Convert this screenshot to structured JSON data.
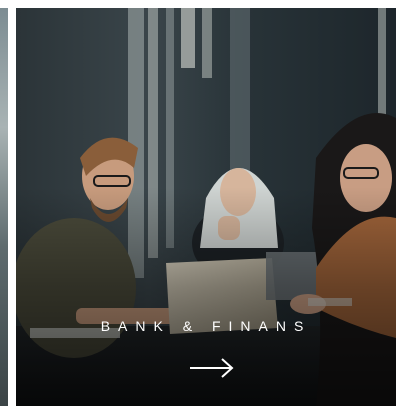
{
  "card": {
    "title": "BANK & FINANS",
    "image": "business-meeting-photo",
    "cta_icon": "arrow-right-icon"
  },
  "colors": {
    "text": "#ffffff",
    "background": "#ffffff"
  }
}
